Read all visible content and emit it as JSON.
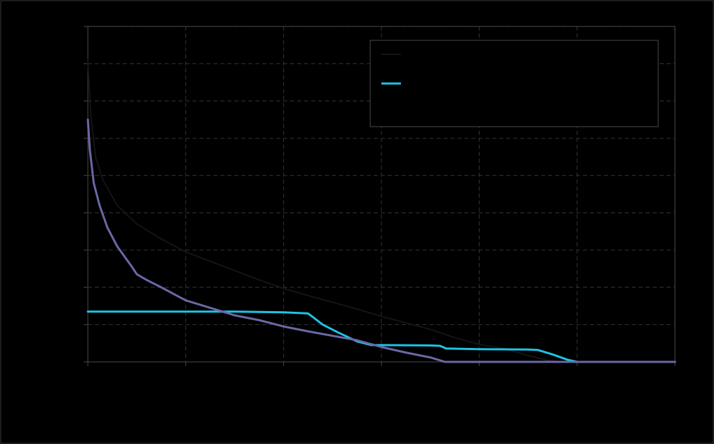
{
  "colors": {
    "background": "#000000",
    "frame": "#3a3a3a",
    "grid": "#2c2c2c",
    "axis": "#3e3e3e",
    "legend_border": "#3e3e3e"
  },
  "chart_data": {
    "type": "line",
    "title": "",
    "xlabel": "",
    "ylabel": "",
    "xlim": [
      0,
      6
    ],
    "ylim": [
      0,
      9
    ],
    "x_ticks": [
      0,
      1,
      2,
      3,
      4,
      5,
      6
    ],
    "y_ticks": [
      0,
      1,
      2,
      3,
      4,
      5,
      6,
      7,
      8,
      9
    ],
    "grid": true,
    "legend_placement": "top-right",
    "series": [
      {
        "name": "",
        "color": "#141414",
        "stroke_width": 2,
        "in_legend": true,
        "points": [
          [
            0,
            8.1
          ],
          [
            0.03,
            6.6
          ],
          [
            0.08,
            5.5
          ],
          [
            0.15,
            4.9
          ],
          [
            0.3,
            4.2
          ],
          [
            0.5,
            3.7
          ],
          [
            0.75,
            3.3
          ],
          [
            1.0,
            2.95
          ],
          [
            1.25,
            2.7
          ],
          [
            1.5,
            2.45
          ],
          [
            1.75,
            2.2
          ],
          [
            2.0,
            1.97
          ],
          [
            2.25,
            1.78
          ],
          [
            2.5,
            1.6
          ],
          [
            2.75,
            1.42
          ],
          [
            3.0,
            1.22
          ],
          [
            3.25,
            1.05
          ],
          [
            3.5,
            0.87
          ],
          [
            3.75,
            0.65
          ],
          [
            4.0,
            0.47
          ],
          [
            4.25,
            0.36
          ],
          [
            4.5,
            0.17
          ],
          [
            4.7,
            0.04
          ],
          [
            4.85,
            0.0
          ],
          [
            6.0,
            0.0
          ]
        ]
      },
      {
        "name": "",
        "color": "#1dc4e6",
        "stroke_width": 3,
        "in_legend": true,
        "points": [
          [
            0,
            1.35
          ],
          [
            1.0,
            1.35
          ],
          [
            1.5,
            1.35
          ],
          [
            2.0,
            1.33
          ],
          [
            2.25,
            1.3
          ],
          [
            2.3,
            1.2
          ],
          [
            2.4,
            1.0
          ],
          [
            2.55,
            0.8
          ],
          [
            2.75,
            0.55
          ],
          [
            2.9,
            0.45
          ],
          [
            3.0,
            0.45
          ],
          [
            3.5,
            0.44
          ],
          [
            3.6,
            0.43
          ],
          [
            3.66,
            0.36
          ],
          [
            4.0,
            0.34
          ],
          [
            4.5,
            0.33
          ],
          [
            4.6,
            0.32
          ],
          [
            4.75,
            0.2
          ],
          [
            4.9,
            0.06
          ],
          [
            5.0,
            0.0
          ],
          [
            6.0,
            0.0
          ]
        ]
      },
      {
        "name": "",
        "color": "#6b68a6",
        "stroke_width": 3,
        "in_legend": false,
        "points": [
          [
            0,
            6.5
          ],
          [
            0.02,
            5.7
          ],
          [
            0.06,
            4.8
          ],
          [
            0.12,
            4.2
          ],
          [
            0.2,
            3.6
          ],
          [
            0.3,
            3.1
          ],
          [
            0.45,
            2.55
          ],
          [
            0.5,
            2.35
          ],
          [
            0.6,
            2.2
          ],
          [
            0.75,
            2.0
          ],
          [
            1.0,
            1.65
          ],
          [
            1.25,
            1.45
          ],
          [
            1.5,
            1.25
          ],
          [
            1.75,
            1.12
          ],
          [
            2.0,
            0.95
          ],
          [
            2.25,
            0.82
          ],
          [
            2.5,
            0.7
          ],
          [
            2.75,
            0.58
          ],
          [
            3.0,
            0.4
          ],
          [
            3.25,
            0.25
          ],
          [
            3.5,
            0.12
          ],
          [
            3.65,
            0.0
          ],
          [
            6.0,
            0.0
          ]
        ]
      }
    ]
  }
}
